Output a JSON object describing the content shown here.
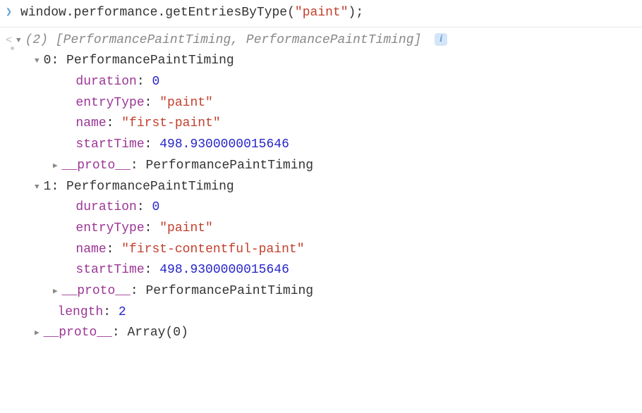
{
  "input": {
    "prefix": "window.performance.getEntriesByType(",
    "arg": "\"paint\"",
    "suffix": ");"
  },
  "output": {
    "count": "(2)",
    "summary": "[PerformancePaintTiming, PerformancePaintTiming]",
    "entries": [
      {
        "index": "0",
        "className": "PerformancePaintTiming",
        "props": {
          "duration_key": "duration",
          "duration_val": "0",
          "entryType_key": "entryType",
          "entryType_val": "\"paint\"",
          "name_key": "name",
          "name_val": "\"first-paint\"",
          "startTime_key": "startTime",
          "startTime_val": "498.9300000015646"
        },
        "proto_key": "__proto__",
        "proto_val": "PerformancePaintTiming"
      },
      {
        "index": "1",
        "className": "PerformancePaintTiming",
        "props": {
          "duration_key": "duration",
          "duration_val": "0",
          "entryType_key": "entryType",
          "entryType_val": "\"paint\"",
          "name_key": "name",
          "name_val": "\"first-contentful-paint\"",
          "startTime_key": "startTime",
          "startTime_val": "498.9300000015646"
        },
        "proto_key": "__proto__",
        "proto_val": "PerformancePaintTiming"
      }
    ],
    "length_key": "length",
    "length_val": "2",
    "proto_key": "__proto__",
    "proto_val": "Array(0)"
  }
}
